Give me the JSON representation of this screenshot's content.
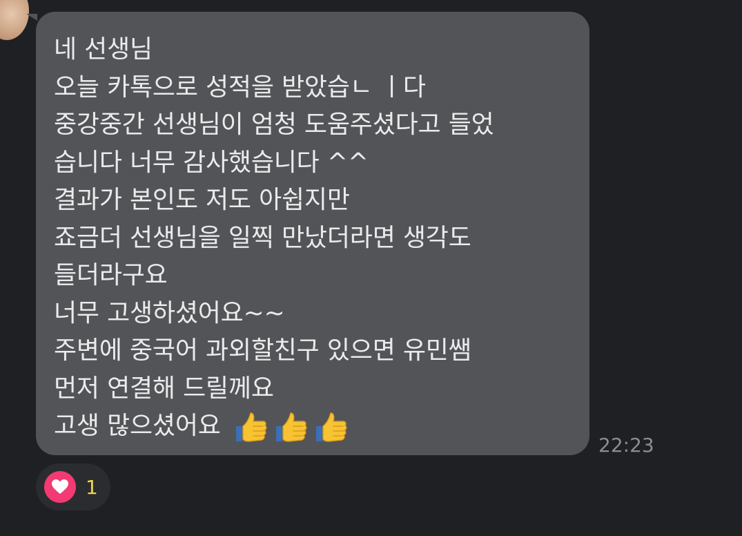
{
  "message": {
    "lines": [
      "네 선생님",
      "오늘 카톡으로 성적을 받았습ㄴ ㅣ다",
      "중강중간 선생님이 엄청 도움주셨다고 들었",
      "습니다 너무 감사했습니다 ^^",
      "결과가 본인도 저도 아쉽지만",
      "죠금더 선생님을 일찍 만났더라면 생각도",
      "들더라구요",
      "너무 고생하셨어요~~",
      "주변에 중국어 과외할친구 있으면 유민쌤",
      "먼저 연결해 드릴께요",
      "고생 많으셨어요"
    ],
    "emojis": [
      "thumbs-up-icon",
      "thumbs-up-icon",
      "thumbs-up-icon"
    ],
    "time": "22:23"
  },
  "reaction": {
    "icon": "heart-icon",
    "count": "1",
    "color": "#f23a74"
  },
  "colors": {
    "background": "#1f2023",
    "bubble": "#525458",
    "text": "#ebebeb",
    "timestamp": "#8d8e91",
    "count": "#f2d64a"
  }
}
